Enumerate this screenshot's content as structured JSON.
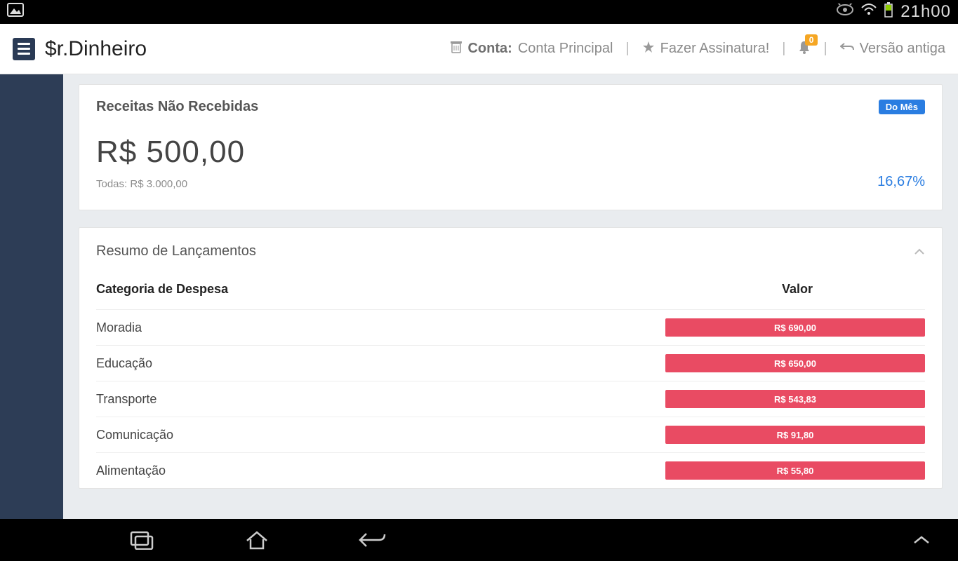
{
  "status_bar": {
    "clock": "21h00"
  },
  "header": {
    "brand": "$r.Dinheiro",
    "account_label": "Conta:",
    "account_value": "Conta Principal",
    "subscribe": "Fazer Assinatura!",
    "notification_count": "0",
    "old_version": "Versão antiga"
  },
  "receitas_card": {
    "title": "Receitas Não Recebidas",
    "chip": "Do Mês",
    "amount": "R$ 500,00",
    "all_label": "Todas:",
    "all_value": "R$ 3.000,00",
    "pct": "16,67%"
  },
  "resumo": {
    "title": "Resumo de Lançamentos",
    "col_category": "Categoria de Despesa",
    "col_value": "Valor",
    "rows": [
      {
        "cat": "Moradia",
        "val": "R$ 690,00"
      },
      {
        "cat": "Educação",
        "val": "R$ 650,00"
      },
      {
        "cat": "Transporte",
        "val": "R$ 543,83"
      },
      {
        "cat": "Comunicação",
        "val": "R$ 91,80"
      },
      {
        "cat": "Alimentação",
        "val": "R$ 55,80"
      }
    ]
  }
}
